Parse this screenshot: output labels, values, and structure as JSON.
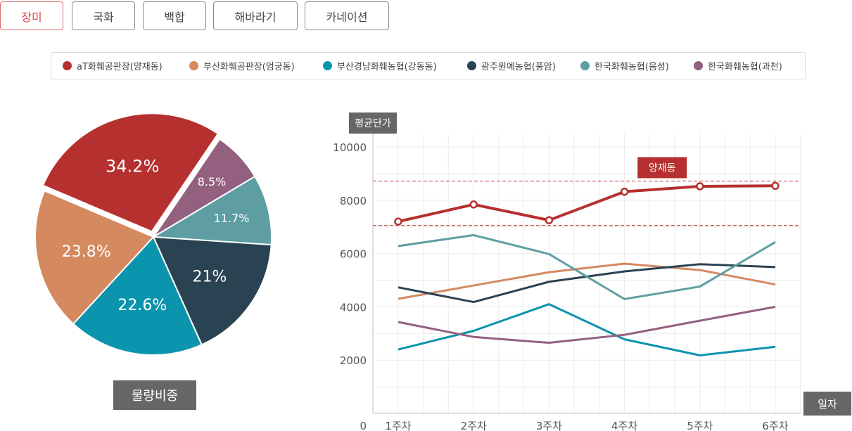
{
  "tabs": [
    {
      "label": "장미",
      "active": true
    },
    {
      "label": "국화",
      "active": false
    },
    {
      "label": "백합",
      "active": false
    },
    {
      "label": "해바라기",
      "active": false
    },
    {
      "label": "카네이션",
      "active": false
    }
  ],
  "legend": [
    {
      "name": "aT화훼공판장(양재동)",
      "color": "#b5302e"
    },
    {
      "name": "부산화훼공판장(엄궁동)",
      "color": "#d5895f"
    },
    {
      "name": "부산경남화훼농협(강동동)",
      "color": "#0b94ad"
    },
    {
      "name": "광주원예농협(풍암)",
      "color": "#2a4352"
    },
    {
      "name": "한국화훼농협(음성)",
      "color": "#5e9ea3"
    },
    {
      "name": "한국화훼농협(과천)",
      "color": "#94607f"
    }
  ],
  "chart_data": [
    {
      "type": "pie",
      "caption": "물량비중",
      "slices": [
        {
          "series": "aT화훼공판장(양재동)",
          "value": 34.2,
          "label": "34.2%",
          "color": "#b5302e",
          "exploded": true
        },
        {
          "series": "한국화훼농협(과천)",
          "value": 8.5,
          "label": "8.5%",
          "color": "#94607f"
        },
        {
          "series": "한국화훼농협(음성)",
          "value": 11.7,
          "label": "11.7%",
          "color": "#5e9ea3"
        },
        {
          "series": "광주원예농협(풍암)",
          "value": 21,
          "label": "21%",
          "color": "#2a4352"
        },
        {
          "series": "부산경남화훼농협(강동동)",
          "value": 22.6,
          "label": "22.6%",
          "color": "#0b94ad"
        },
        {
          "series": "부산화훼공판장(엄궁동)",
          "value": 23.8,
          "label": "23.8%",
          "color": "#d5895f"
        }
      ]
    },
    {
      "type": "line",
      "ylabel": "평균단가",
      "xlabel": "일자",
      "ylim": [
        0,
        10500
      ],
      "yticks": [
        10000,
        8000,
        6000,
        4000,
        2000
      ],
      "zero_label": "0",
      "grid": true,
      "categories": [
        "1주차",
        "2주차",
        "3주차",
        "4주차",
        "5주차",
        "6주차"
      ],
      "series": [
        {
          "name": "부산화훼공판장(엄궁동)",
          "color": "#d5895f",
          "values": [
            4300,
            4800,
            5300,
            5620,
            5380,
            4840
          ]
        },
        {
          "name": "부산경남화훼농협(강동동)",
          "color": "#0b94ad",
          "values": [
            2400,
            3100,
            4100,
            2780,
            2180,
            2500
          ]
        },
        {
          "name": "광주원예농협(풍암)",
          "color": "#2a4352",
          "values": [
            4730,
            4180,
            4940,
            5330,
            5600,
            5490
          ]
        },
        {
          "name": "한국화훼농협(음성)",
          "color": "#5e9ea3",
          "values": [
            6280,
            6690,
            5980,
            4290,
            4760,
            6430
          ]
        },
        {
          "name": "한국화훼농협(과천)",
          "color": "#94607f",
          "values": [
            3430,
            2870,
            2650,
            2950,
            3480,
            4000
          ]
        },
        {
          "name": "aT화훼공판장(양재동)",
          "color": "#b5302e",
          "values": [
            7200,
            7840,
            7250,
            8320,
            8520,
            8540
          ],
          "highlight": true,
          "markers": true
        }
      ],
      "band": {
        "low": 7050,
        "high": 8720,
        "color": "#b5302e"
      },
      "annotation": {
        "text": "양재동"
      }
    }
  ]
}
